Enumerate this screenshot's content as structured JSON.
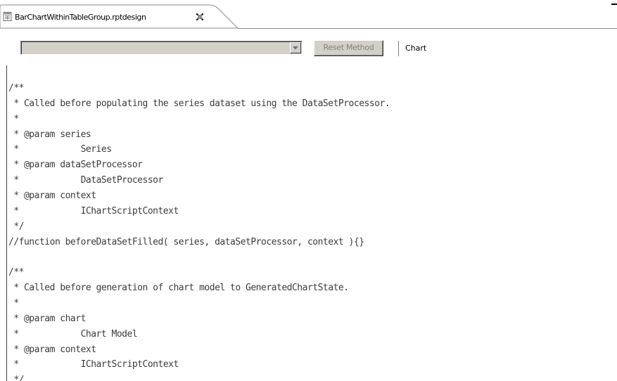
{
  "editor_tab": {
    "title": "BarChartWithinTableGroup.rptdesign",
    "icon": "report-design-file-icon",
    "close_icon": "close-icon"
  },
  "toolbar": {
    "method_select_value": "",
    "reset_method_label": "Reset Method",
    "context_label": "Chart"
  },
  "code": {
    "lines": [
      "/**",
      " * Called before populating the series dataset using the DataSetProcessor.",
      " *",
      " * @param series",
      " *            Series",
      " * @param dataSetProcessor",
      " *            DataSetProcessor",
      " * @param context",
      " *            IChartScriptContext",
      " */",
      "//function beforeDataSetFilled( series, dataSetProcessor, context ){}",
      "",
      "/**",
      " * Called before generation of chart model to GeneratedChartState.",
      " *",
      " * @param chart",
      " *            Chart Model",
      " * @param context",
      " *            IChartScriptContext",
      " */"
    ]
  },
  "colors": {
    "code_text": "#3c3c3c",
    "disabled_text": "#808080",
    "control_face": "#d4d0c8"
  }
}
